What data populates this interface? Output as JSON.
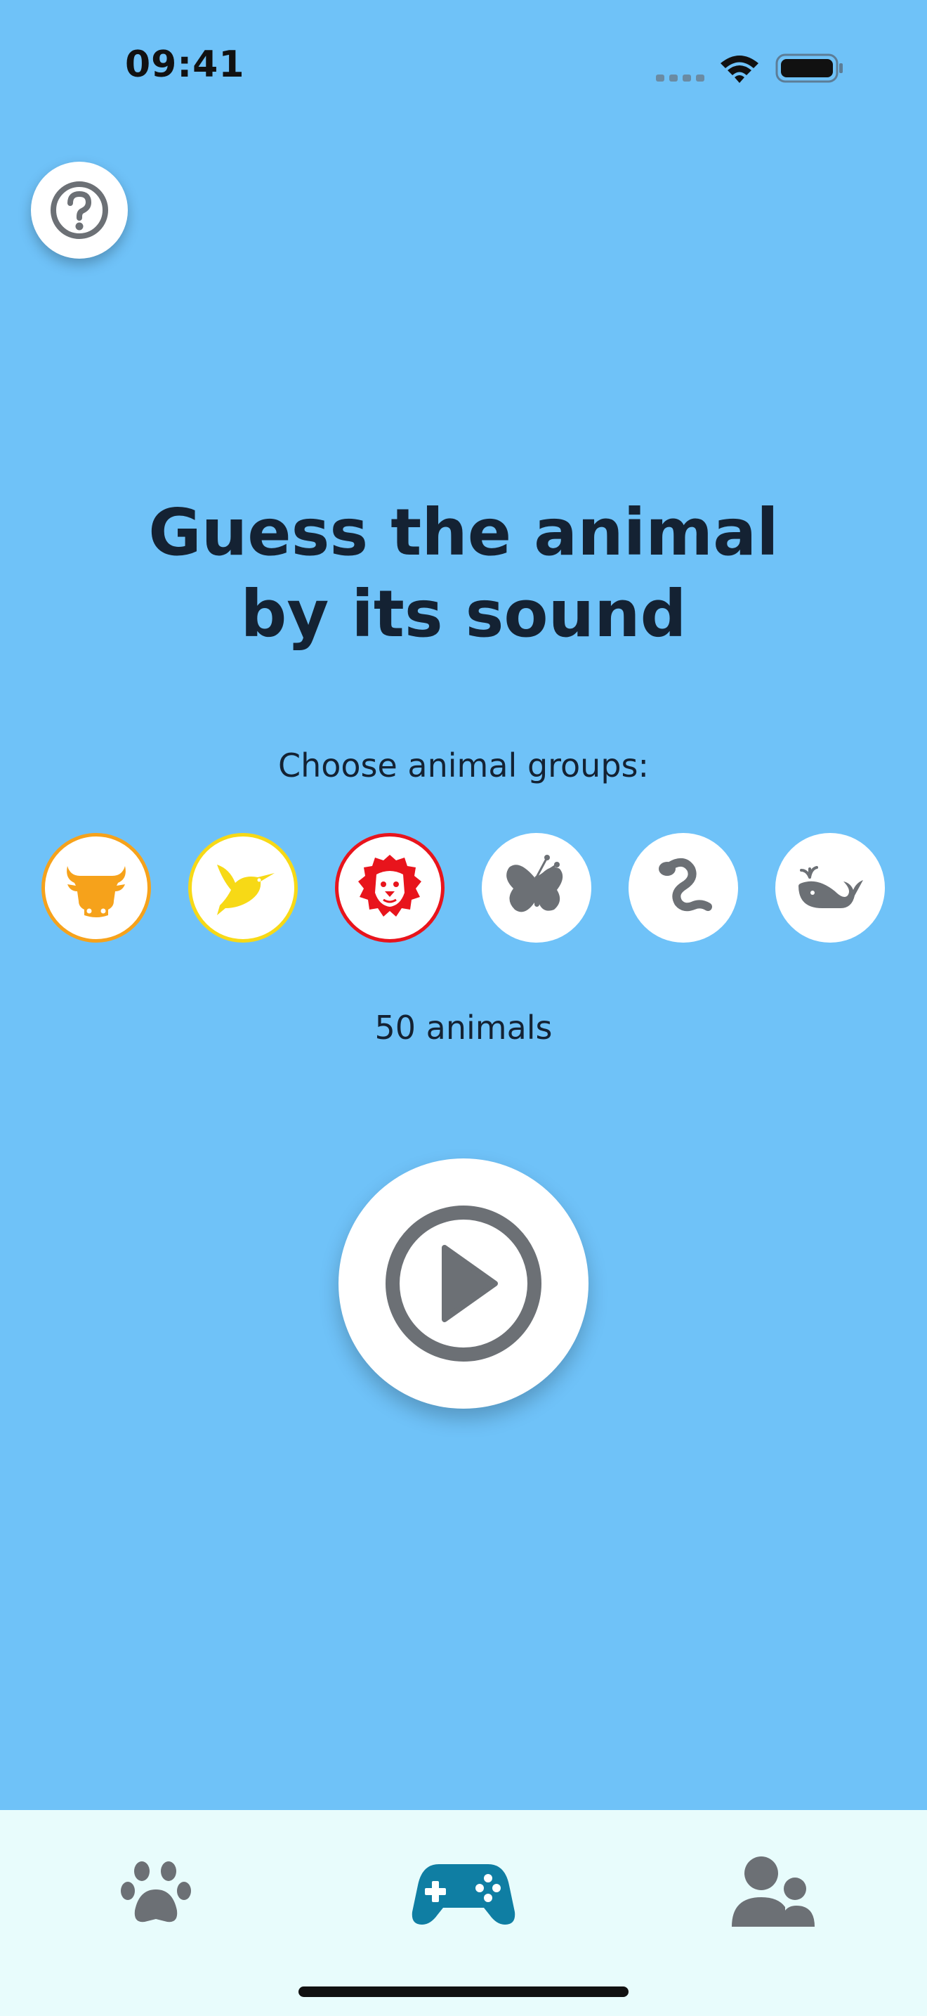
{
  "status_bar": {
    "time": "09:41"
  },
  "help": {
    "icon": "question-circle-icon"
  },
  "title": "Guess the animal by its sound",
  "groups_label": "Choose animal groups:",
  "groups": [
    {
      "name": "farm-animals",
      "icon": "cow-icon",
      "selected": true,
      "color": "#f6a21b"
    },
    {
      "name": "birds",
      "icon": "bird-icon",
      "selected": true,
      "color": "#f7d916"
    },
    {
      "name": "wild-animals",
      "icon": "lion-icon",
      "selected": true,
      "color": "#e8141c"
    },
    {
      "name": "insects",
      "icon": "butterfly-icon",
      "selected": false,
      "color": "#6c7075"
    },
    {
      "name": "reptiles",
      "icon": "snake-icon",
      "selected": false,
      "color": "#6c7075"
    },
    {
      "name": "sea-animals",
      "icon": "whale-icon",
      "selected": false,
      "color": "#6c7075"
    }
  ],
  "animal_count": "50 animals",
  "play": {
    "icon": "play-circle-icon"
  },
  "tabbar": {
    "tabs": [
      {
        "name": "animals",
        "icon": "paw-icon",
        "active": false
      },
      {
        "name": "game",
        "icon": "gamepad-icon",
        "active": true
      },
      {
        "name": "profile",
        "icon": "users-icon",
        "active": false
      }
    ]
  },
  "colors": {
    "background": "#6fc2f8",
    "tabbar_background": "#e8fcfc",
    "active_tab": "#0f7ea3",
    "inactive_icon": "#6c7075",
    "text": "#142233"
  }
}
